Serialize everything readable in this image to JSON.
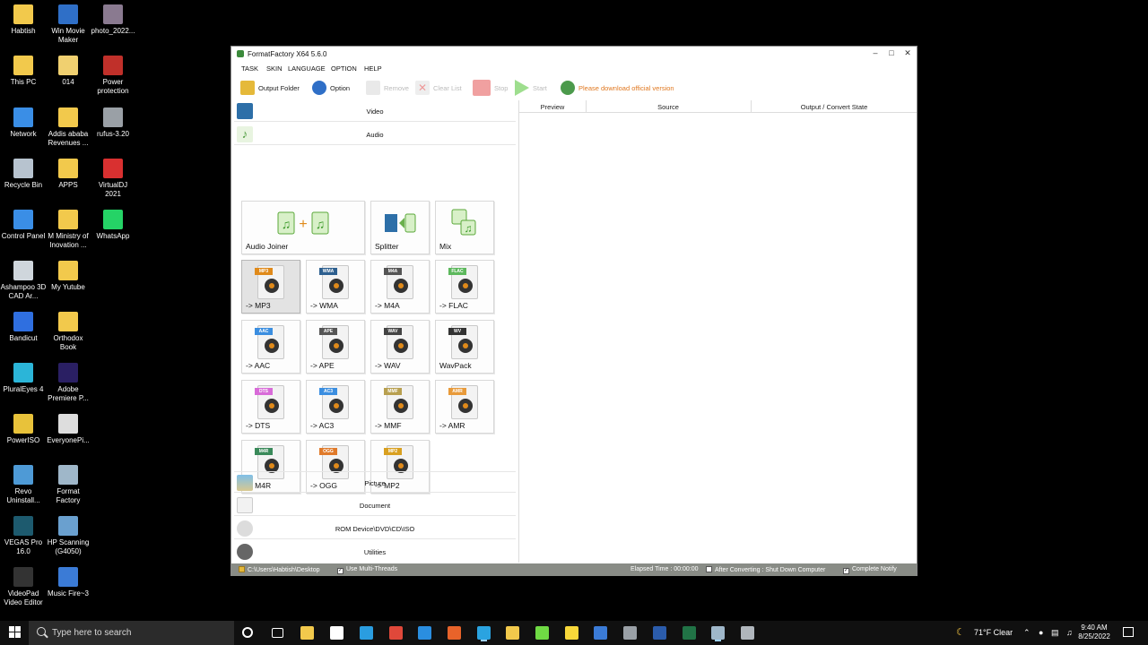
{
  "desktop_icons": [
    {
      "label": "Habtish",
      "icon": "folder-icon",
      "color": "#f2c94c"
    },
    {
      "label": "Win Movie Maker",
      "icon": "movie-maker-icon",
      "color": "#2f6fc7"
    },
    {
      "label": "photo_2022...",
      "icon": "photo-icon",
      "color": "#8a7a90"
    },
    {
      "label": "This PC",
      "icon": "folder-icon",
      "color": "#f2c94c"
    },
    {
      "label": "014",
      "icon": "file-icon",
      "color": "#f0d070"
    },
    {
      "label": "Power protection",
      "icon": "power-icon",
      "color": "#c0302a"
    },
    {
      "label": "Network",
      "icon": "network-icon",
      "color": "#3a8ee6"
    },
    {
      "label": "Addis ababa Revenues ...",
      "icon": "folder-icon",
      "color": "#f2c94c"
    },
    {
      "label": "rufus-3.20",
      "icon": "usb-icon",
      "color": "#9aa0a6"
    },
    {
      "label": "Recycle Bin",
      "icon": "recycle-bin-icon",
      "color": "#b7c3cf"
    },
    {
      "label": "APPS",
      "icon": "folder-icon",
      "color": "#f2c94c"
    },
    {
      "label": "VirtualDJ 2021",
      "icon": "virtualdj-icon",
      "color": "#d93030"
    },
    {
      "label": "Control Panel",
      "icon": "control-panel-icon",
      "color": "#3a8ee6"
    },
    {
      "label": "M Ministry of Inovation ...",
      "icon": "folder-icon",
      "color": "#f2c94c"
    },
    {
      "label": "WhatsApp",
      "icon": "whatsapp-icon",
      "color": "#25d366"
    },
    {
      "label": "Ashampoo 3D CAD Ar...",
      "icon": "ashampoo-icon",
      "color": "#cfd6dc"
    },
    {
      "label": "My Yutube",
      "icon": "folder-icon",
      "color": "#f2c94c"
    },
    {
      "label": "Bandicut",
      "icon": "bandicut-icon",
      "color": "#2f6fe0"
    },
    {
      "label": "Orthodox Book",
      "icon": "folder-icon",
      "color": "#f2c94c"
    },
    {
      "label": "PluralEyes 4",
      "icon": "pluraleyes-icon",
      "color": "#2bb5d8"
    },
    {
      "label": "Adobe Premiere P...",
      "icon": "premiere-icon",
      "color": "#2a1f63"
    },
    {
      "label": "PowerISO",
      "icon": "poweriso-icon",
      "color": "#e8c23a"
    },
    {
      "label": "EveryonePi...",
      "icon": "piano-icon",
      "color": "#dddddd"
    },
    {
      "label": "Revo Uninstall...",
      "icon": "revo-icon",
      "color": "#4e9ad6"
    },
    {
      "label": "Format Factory",
      "icon": "format-factory-icon",
      "color": "#9fb7c9"
    },
    {
      "label": "VEGAS Pro 16.0",
      "icon": "vegas-icon",
      "color": "#1d5a6e"
    },
    {
      "label": "HP Scanning (G4050)",
      "icon": "scanner-icon",
      "color": "#6aa0cf"
    },
    {
      "label": "VideoPad Video Editor",
      "icon": "videopad-icon",
      "color": "#333333"
    },
    {
      "label": "Music Fire~3",
      "icon": "document-icon",
      "color": "#3b7bd6"
    }
  ],
  "window": {
    "title": "FormatFactory X64 5.6.0",
    "menu": [
      "TASK",
      "SKIN",
      "LANGUAGE",
      "OPTION",
      "HELP"
    ],
    "toolbar": {
      "output_folder": "Output Folder",
      "option": "Option",
      "remove": "Remove",
      "clear_list": "Clear List",
      "stop": "Stop",
      "start": "Start",
      "download_notice": "Please download official version"
    },
    "categories": {
      "video": "Video",
      "audio": "Audio",
      "picture": "Picture",
      "document": "Document",
      "rom": "ROM Device\\DVD\\CD\\ISO",
      "utilities": "Utilities"
    },
    "audio_tools": [
      {
        "label": "Audio Joiner",
        "icon": "audio-joiner-icon"
      },
      {
        "label": "Splitter",
        "icon": "splitter-icon"
      },
      {
        "label": "Mix",
        "icon": "mix-icon"
      }
    ],
    "formats": [
      {
        "label": "-> MP3",
        "tag": "MP3",
        "tag_color": "#e08a1a",
        "selected": true
      },
      {
        "label": "-> WMA",
        "tag": "WMA",
        "tag_color": "#2d5f8f"
      },
      {
        "label": "-> M4A",
        "tag": "M4A",
        "tag_color": "#555555"
      },
      {
        "label": "-> FLAC",
        "tag": "FLAC",
        "tag_color": "#5cb85c"
      },
      {
        "label": "-> AAC",
        "tag": "AAC",
        "tag_color": "#3b8ee0"
      },
      {
        "label": "-> APE",
        "tag": "APE",
        "tag_color": "#555555"
      },
      {
        "label": "-> WAV",
        "tag": "WAV",
        "tag_color": "#444444"
      },
      {
        "label": "WavPack",
        "tag": "WV",
        "tag_color": "#333333"
      },
      {
        "label": "-> DTS",
        "tag": "DTS",
        "tag_color": "#d86bd8"
      },
      {
        "label": "-> AC3",
        "tag": "AC3",
        "tag_color": "#3b8ee0"
      },
      {
        "label": "-> MMF",
        "tag": "MMF",
        "tag_color": "#b8a050"
      },
      {
        "label": "-> AMR",
        "tag": "AMR",
        "tag_color": "#e89a3a"
      },
      {
        "label": "-> M4R",
        "tag": "M4R",
        "tag_color": "#3a8a5a"
      },
      {
        "label": "-> OGG",
        "tag": "OGG",
        "tag_color": "#e07a2a"
      },
      {
        "label": "-> MP2",
        "tag": "MP2",
        "tag_color": "#d9a020"
      }
    ],
    "table_headers": {
      "preview": "Preview",
      "source": "Source",
      "state": "Output / Convert State"
    },
    "status": {
      "path": "C:\\Users\\Habtish\\Desktop",
      "multithreads": "Use Multi-Threads",
      "elapsed": "Elapsed Time : 00:00:00",
      "after_converting": "After Converting : Shut Down Computer",
      "complete_notify": "Complete Notify"
    }
  },
  "taskbar": {
    "search_placeholder": "Type here to search",
    "weather": "71°F  Clear",
    "time": "9:40 AM",
    "date": "8/25/2022",
    "apps": [
      {
        "icon": "cortana-icon",
        "color": "#101010"
      },
      {
        "icon": "task-view-icon",
        "color": "#101010"
      },
      {
        "icon": "store-icon",
        "color": "#f2c94c"
      },
      {
        "icon": "mail-icon",
        "color": "#ffffff"
      },
      {
        "icon": "edge-icon",
        "color": "#2a9de0"
      },
      {
        "icon": "chrome-icon",
        "color": "#e0483a"
      },
      {
        "icon": "ie-icon",
        "color": "#2a8ee0"
      },
      {
        "icon": "firefox-icon",
        "color": "#e8632a"
      },
      {
        "icon": "telegram-icon",
        "color": "#2aa3e0"
      },
      {
        "icon": "file-explorer-icon",
        "color": "#f2c94c"
      },
      {
        "icon": "upwork-icon",
        "color": "#6fda44"
      },
      {
        "icon": "sticky-notes-icon",
        "color": "#f7d73a"
      },
      {
        "icon": "notepad-icon",
        "color": "#3b7bd6"
      },
      {
        "icon": "settings-app-icon",
        "color": "#9aa0a6"
      },
      {
        "icon": "word-icon",
        "color": "#2b5cab"
      },
      {
        "icon": "excel-icon",
        "color": "#217346"
      },
      {
        "icon": "format-factory-taskbar-icon",
        "color": "#9fb7c9"
      },
      {
        "icon": "gear-app-icon",
        "color": "#b0b6bc"
      }
    ]
  }
}
